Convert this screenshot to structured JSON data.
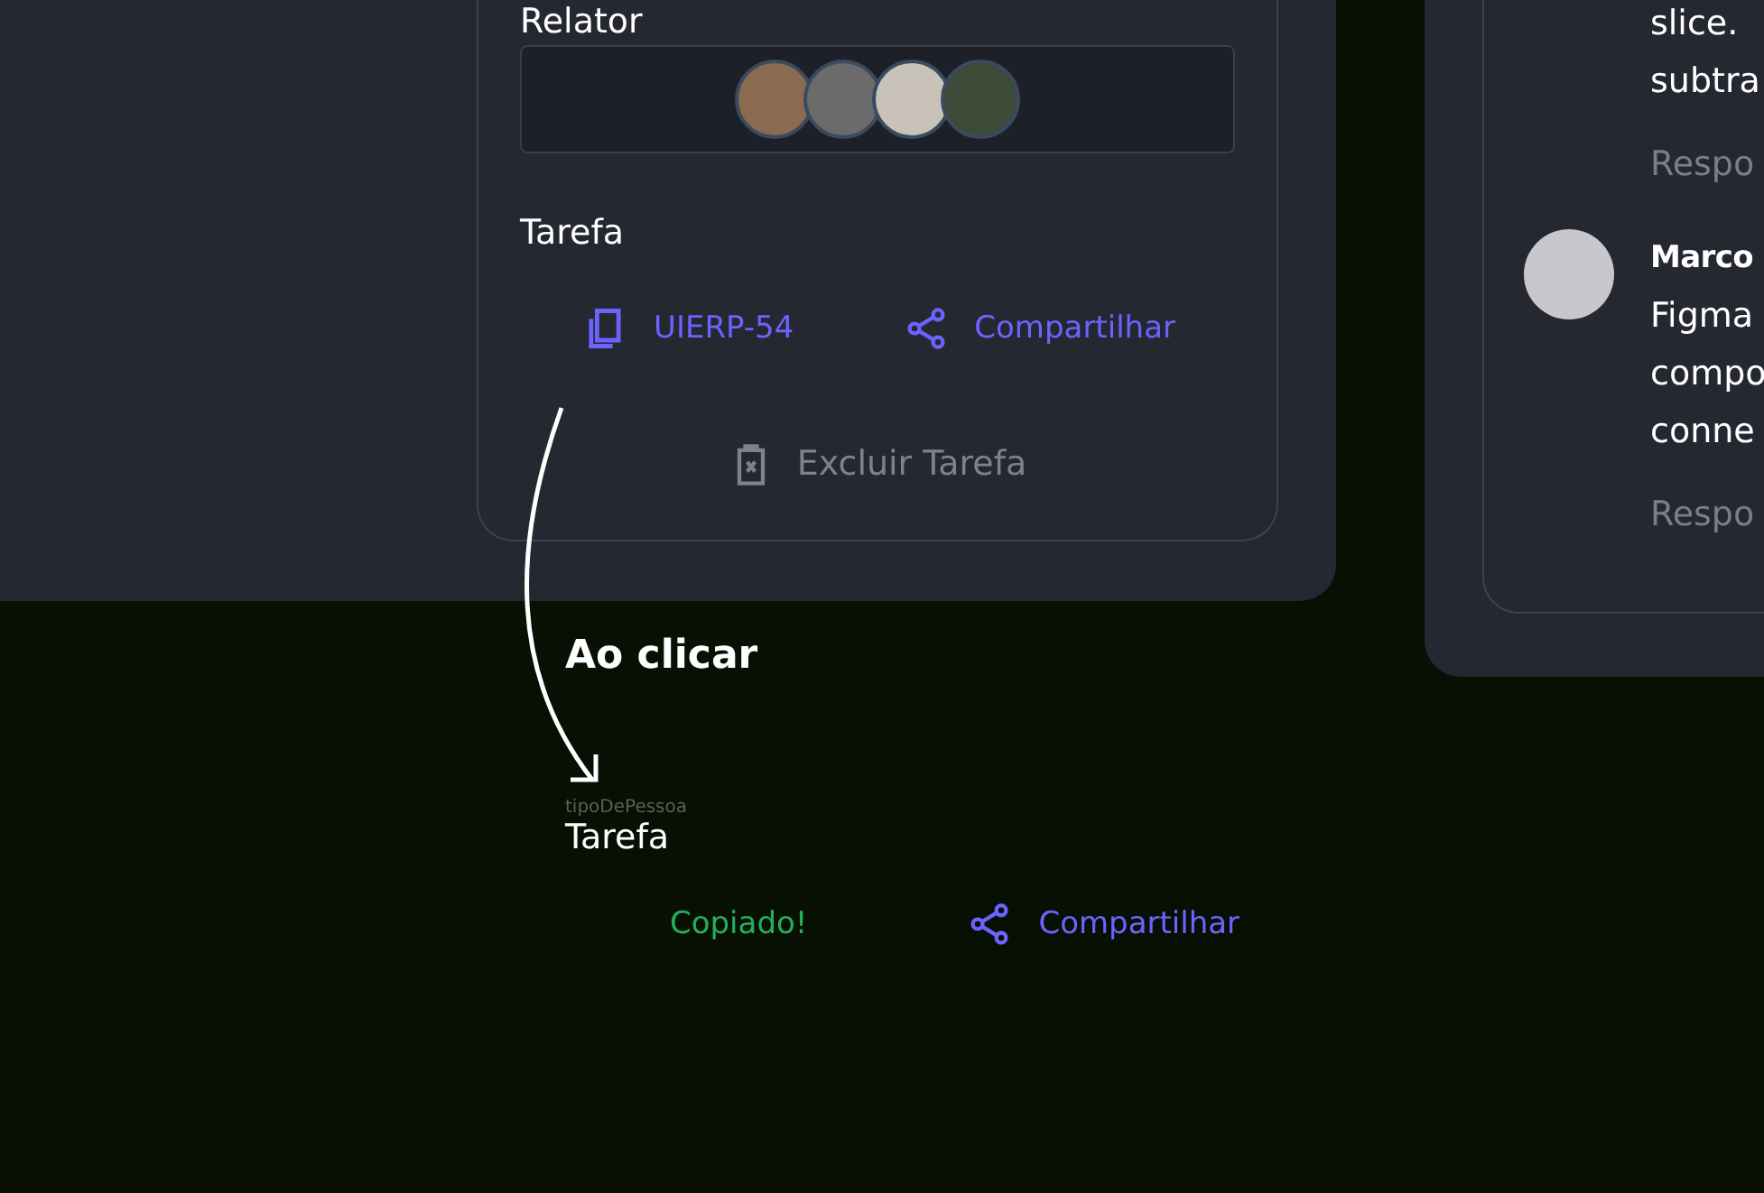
{
  "task_panel": {
    "reporter_label": "Relator",
    "task_label": "Tarefa",
    "actions": [
      {
        "kind": "copy",
        "label": "UIERP-54"
      },
      {
        "kind": "share",
        "label": "Compartilhar"
      }
    ],
    "delete_label": "Excluir Tarefa"
  },
  "comments_panel": {
    "lines_top": [
      "slice. ",
      "subtra"
    ],
    "reply_top": "Respo",
    "author": "Marco",
    "body": [
      "Figma",
      "compo",
      "conne"
    ],
    "reply_bottom": "Respo"
  },
  "annotation": {
    "caption": "Ao clicar"
  },
  "after_click": {
    "layer_name": "tipoDePessoa",
    "task_label": "Tarefa",
    "actions": [
      {
        "kind": "copied",
        "label": "Copiado!"
      },
      {
        "kind": "share",
        "label": "Compartilhar"
      }
    ]
  }
}
